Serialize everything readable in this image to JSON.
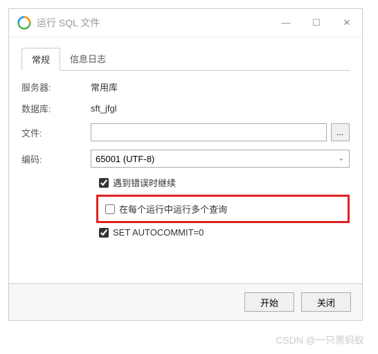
{
  "window": {
    "title": "运行 SQL 文件"
  },
  "tabs": {
    "general": "常规",
    "messages": "信息日志"
  },
  "labels": {
    "server": "服务器:",
    "database": "数据库:",
    "file": "文件:",
    "encoding": "编码:"
  },
  "values": {
    "server": "常用库",
    "database": "sft_jfgl",
    "file": "",
    "encoding": "65001 (UTF-8)",
    "browse": "..."
  },
  "checkboxes": {
    "continue_on_error": {
      "label": "遇到错误时继续",
      "checked": true
    },
    "multi_query": {
      "label": "在每个运行中运行多个查询",
      "checked": false
    },
    "autocommit": {
      "label": "SET AUTOCOMMIT=0",
      "checked": true
    }
  },
  "buttons": {
    "start": "开始",
    "close": "关闭"
  },
  "watermark": "CSDN @一只黑蚂蚁"
}
